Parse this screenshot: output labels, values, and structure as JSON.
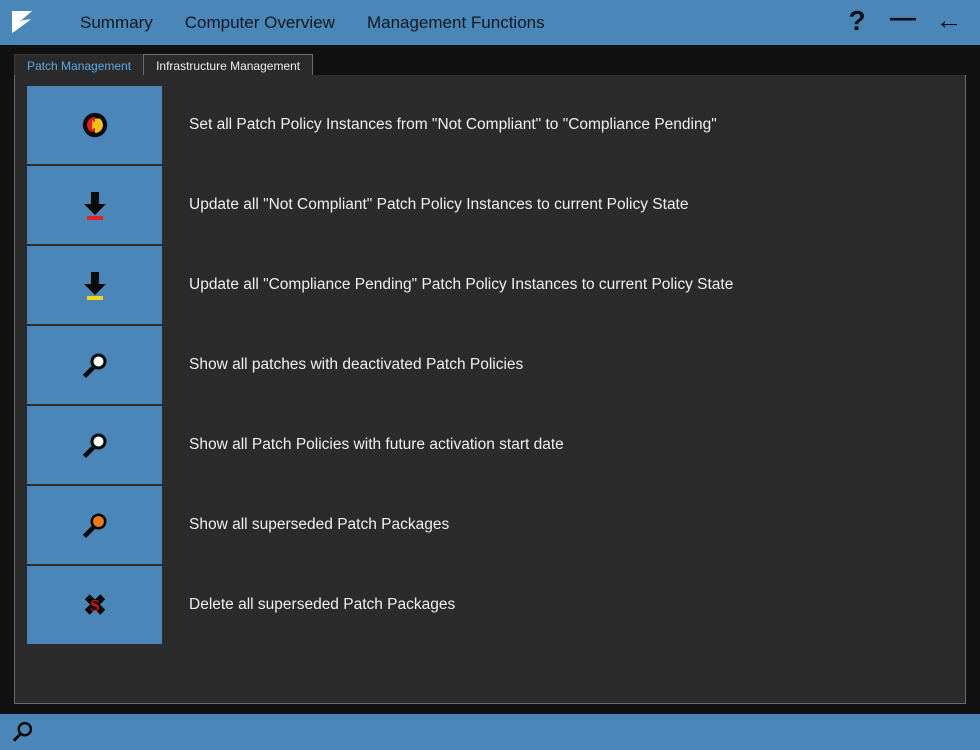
{
  "app": {
    "logo_icon": "baramundi-z-logo",
    "accent_blue": "#4a86b8",
    "panel_bg": "#2b2b2b",
    "window_bg": "#111111",
    "active_tab_color": "#5aa9e6"
  },
  "topbar": {
    "nav": [
      {
        "label": "Summary",
        "name": "nav-item-summary"
      },
      {
        "label": "Computer Overview",
        "name": "nav-item-computer-overview"
      },
      {
        "label": "Management Functions",
        "name": "nav-item-management-functions"
      }
    ],
    "controls": {
      "help": "?",
      "minimize": "—",
      "back": "←"
    }
  },
  "tabs": [
    {
      "label": "Patch Management",
      "active": true
    },
    {
      "label": "Infrastructure Management",
      "active": false
    }
  ],
  "actions": [
    {
      "icon": "refresh-circle-red-yellow-icon",
      "label": "Set all Patch Policy Instances from \"Not Compliant\" to \"Compliance Pending\""
    },
    {
      "icon": "download-arrow-red-bar-icon",
      "label": "Update all \"Not Compliant\" Patch Policy Instances to current Policy State"
    },
    {
      "icon": "download-arrow-yellow-bar-icon",
      "label": "Update all \"Compliance Pending\" Patch Policy Instances to current Policy State"
    },
    {
      "icon": "magnifier-white-icon",
      "label": "Show all patches with deactivated Patch Policies"
    },
    {
      "icon": "magnifier-white-icon",
      "label": "Show all Patch Policies with future activation start date"
    },
    {
      "icon": "magnifier-orange-icon",
      "label": "Show all superseded Patch Packages"
    },
    {
      "icon": "delete-x-superseded-icon",
      "label": "Delete all superseded Patch Packages"
    }
  ],
  "bottombar": {
    "search_icon": "magnifier-icon"
  }
}
